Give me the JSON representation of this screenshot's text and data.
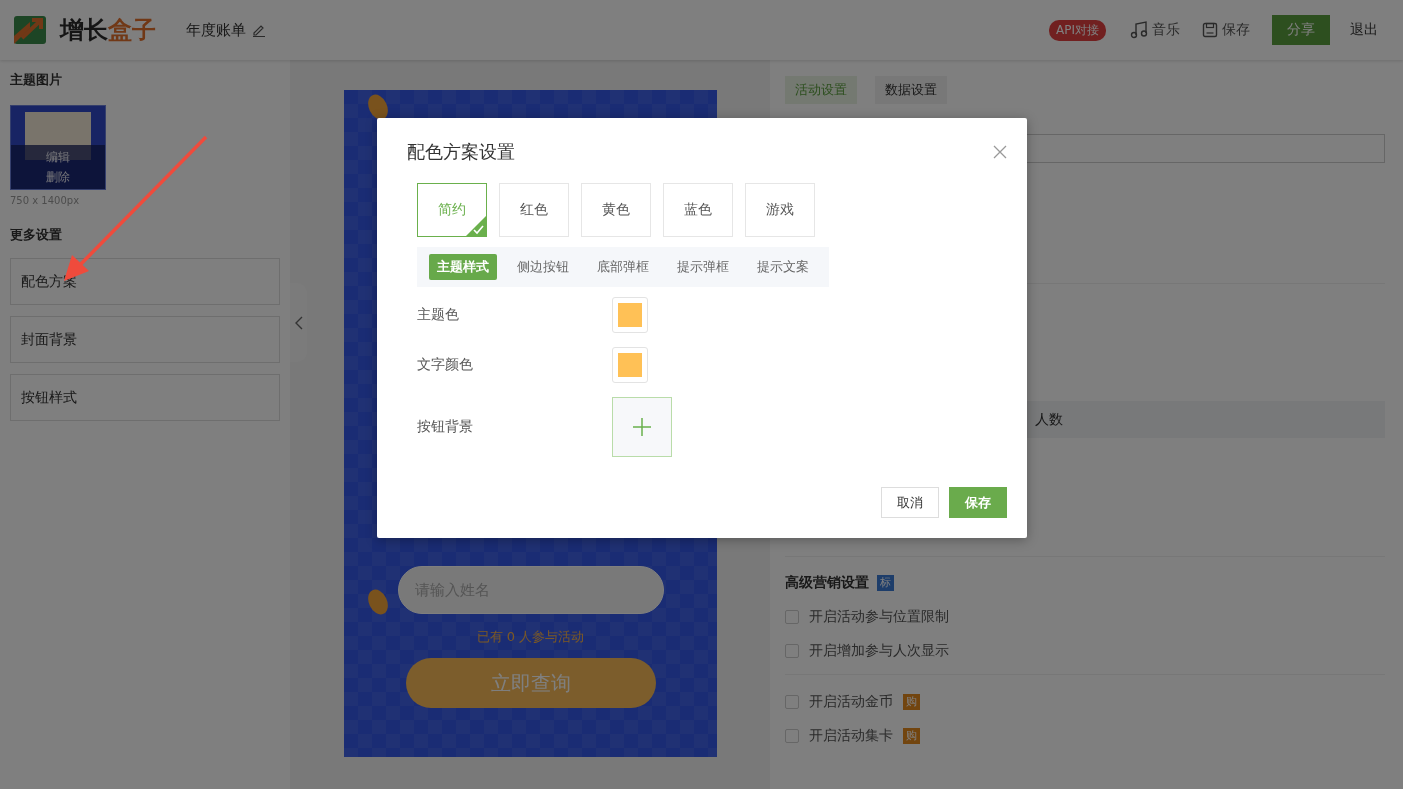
{
  "header": {
    "logo_dark": "增长",
    "logo_accent": "盒子",
    "doc_title": "年度账单",
    "api_badge": "API对接",
    "actions": [
      {
        "label": "音乐",
        "kind": "music"
      },
      {
        "label": "保存",
        "kind": "save"
      }
    ],
    "share_button": "分享",
    "exit_link": "退出"
  },
  "left_panel": {
    "theme_image_heading": "主题图片",
    "thumbnail_actions": [
      "编辑",
      "删除"
    ],
    "image_size": "750 x 1400px",
    "more_heading": "更多设置",
    "settings": [
      "配色方案",
      "封面背景",
      "按钮样式"
    ]
  },
  "preview": {
    "name_placeholder": "请输入姓名",
    "participants": "已有 0 人参与活动",
    "query_button": "立即查询"
  },
  "right_panel": {
    "tabs": [
      {
        "label": "活动设置",
        "selected": true
      },
      {
        "label": "数据设置",
        "selected": false
      }
    ],
    "partial_text": "人数",
    "advanced_heading": "高级营销设置",
    "advanced_badge": "标",
    "options": [
      {
        "label": "开启活动参与位置限制",
        "checked": false
      },
      {
        "label": "开启增加参与人次显示",
        "checked": false
      }
    ],
    "paid_options": [
      {
        "label": "开启活动金币",
        "checked": false,
        "badge": "购"
      },
      {
        "label": "开启活动集卡",
        "checked": false,
        "badge": "购"
      }
    ]
  },
  "dialog": {
    "title": "配色方案设置",
    "schemes": [
      {
        "label": "简约",
        "selected": true
      },
      {
        "label": "红色",
        "selected": false
      },
      {
        "label": "黄色",
        "selected": false
      },
      {
        "label": "蓝色",
        "selected": false
      },
      {
        "label": "游戏",
        "selected": false
      }
    ],
    "subtabs": [
      {
        "label": "主题样式",
        "selected": true
      },
      {
        "label": "侧边按钮",
        "selected": false
      },
      {
        "label": "底部弹框",
        "selected": false
      },
      {
        "label": "提示弹框",
        "selected": false
      },
      {
        "label": "提示文案",
        "selected": false
      }
    ],
    "fields": [
      {
        "label": "主题色",
        "kind": "color",
        "color": "#ffc156"
      },
      {
        "label": "文字颜色",
        "kind": "color",
        "color": "#ffc156"
      },
      {
        "label": "按钮背景",
        "kind": "upload"
      }
    ],
    "cancel_button": "取消",
    "save_button": "保存"
  }
}
